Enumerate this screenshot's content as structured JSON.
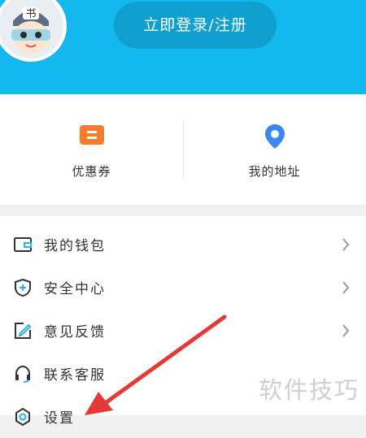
{
  "header": {
    "login_label": "立即登录/注册",
    "brand_color": "#13b9ee",
    "avatar_badge": "书"
  },
  "quick_actions": [
    {
      "label": "优惠券",
      "icon": "coupon-icon",
      "color": "#f57c2b"
    },
    {
      "label": "我的地址",
      "icon": "location-pin-icon",
      "color": "#3a86f3"
    }
  ],
  "menu": [
    {
      "label": "我的钱包",
      "icon": "wallet-icon",
      "chevron": true
    },
    {
      "label": "安全中心",
      "icon": "shield-plus-icon",
      "chevron": true
    },
    {
      "label": "意见反馈",
      "icon": "edit-feedback-icon",
      "chevron": true
    },
    {
      "label": "联系客服",
      "icon": "headset-icon",
      "chevron": false
    },
    {
      "label": "设置",
      "icon": "settings-icon",
      "chevron": false
    }
  ],
  "watermark": "软件技巧",
  "annotation": {
    "arrow_color": "#e53935"
  }
}
